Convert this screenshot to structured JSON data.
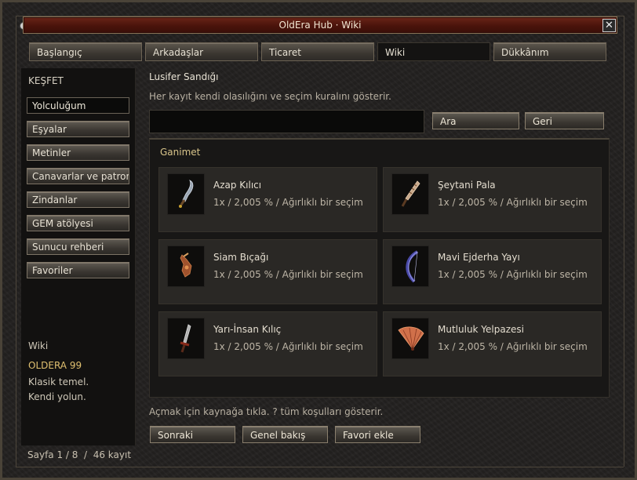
{
  "window": {
    "title": "OldEra Hub · Wiki",
    "close_glyph": "✕"
  },
  "tabs": [
    {
      "label": "Başlangıç"
    },
    {
      "label": "Arkadaşlar"
    },
    {
      "label": "Ticaret"
    },
    {
      "label": "Wiki",
      "active": true
    },
    {
      "label": "Dükkânım"
    }
  ],
  "sidebar": {
    "heading": "KEŞFET",
    "items": [
      {
        "label": "Yolculuğum",
        "active": true
      },
      {
        "label": "Eşyalar"
      },
      {
        "label": "Metinler"
      },
      {
        "label": "Canavarlar ve patronlar"
      },
      {
        "label": "Zindanlar"
      },
      {
        "label": "GEM atölyesi"
      },
      {
        "label": "Sunucu rehberi"
      },
      {
        "label": "Favoriler"
      }
    ],
    "footer": {
      "section": "Wiki",
      "server": "OLDERA 99",
      "line1": "Klasik temel.",
      "line2": "Kendi yolun."
    }
  },
  "main": {
    "title": "Lusifer Sandığı",
    "description": "Her kayıt kendi olasılığını ve seçim kuralını gösterir.",
    "search": {
      "value": "",
      "placeholder": ""
    },
    "search_button": "Ara",
    "back_button": "Geri",
    "loot": {
      "title": "Ganimet",
      "items": [
        {
          "name": "Azap Kılıcı",
          "detail": "1x / 2,005 % / Ağırlıklı bir seçim",
          "icon": "sword-icon"
        },
        {
          "name": "Şeytani Pala",
          "detail": "1x / 2,005 % / Ağırlıklı bir seçim",
          "icon": "blade-icon"
        },
        {
          "name": "Siam Bıçağı",
          "detail": "1x / 2,005 % / Ağırlıklı bir seçim",
          "icon": "dagger-icon"
        },
        {
          "name": "Mavi Ejderha Yayı",
          "detail": "1x / 2,005 % / Ağırlıklı bir seçim",
          "icon": "bow-icon"
        },
        {
          "name": "Yarı-İnsan Kılıç",
          "detail": "1x / 2,005 % / Ağırlıklı bir seçim",
          "icon": "sword-icon"
        },
        {
          "name": "Mutluluk Yelpazesi",
          "detail": "1x / 2,005 % / Ağırlıklı bir seçim",
          "icon": "fan-icon"
        }
      ]
    },
    "hint": "Açmak için kaynağa tıkla. ? tüm koşulları gösterir.",
    "actions": {
      "next": "Sonraki",
      "overview": "Genel bakış",
      "favorite": "Favori ekle"
    }
  },
  "status": "Sayfa 1 / 8  /  46 kayıt",
  "colors": {
    "accent_gold": "#d8c48a",
    "title_bar": "#5a1c10",
    "server_name": "#e0c070"
  }
}
